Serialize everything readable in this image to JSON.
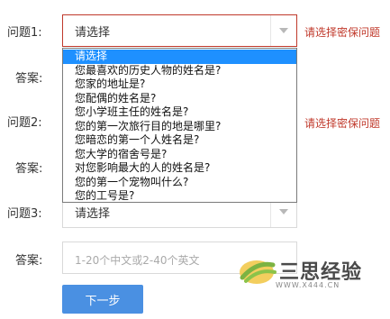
{
  "rows": [
    {
      "question_label": "问题1:",
      "select_value": "请选择",
      "error": "请选择密保问题"
    },
    {
      "question_label": "问题2:",
      "error": "请选择密保问题"
    },
    {
      "question_label": "问题3:",
      "select_value": "请选择"
    }
  ],
  "answer_label": "答案:",
  "answer3_placeholder": "1-20个中文或2-40个英文",
  "dropdown": {
    "options": [
      "请选择",
      "您最喜欢的历史人物的姓名是?",
      "您家的地址是?",
      "您配偶的姓名是?",
      "您小学班主任的姓名是?",
      "您的第一次旅行目的地是哪里?",
      "您暗恋的第一个人姓名是?",
      "您大学的宿舍号是?",
      "对您影响最大的人的姓名是?",
      "您的第一个宠物叫什么?",
      "您的工号是?"
    ],
    "selected_index": 0
  },
  "next_button": "下一步",
  "watermark": {
    "text": "三思经验",
    "url": "WWW.X444.CN"
  },
  "colors": {
    "error": "#c0392b",
    "accent": "#4a90e2",
    "selected_option": "#1e90ff"
  }
}
